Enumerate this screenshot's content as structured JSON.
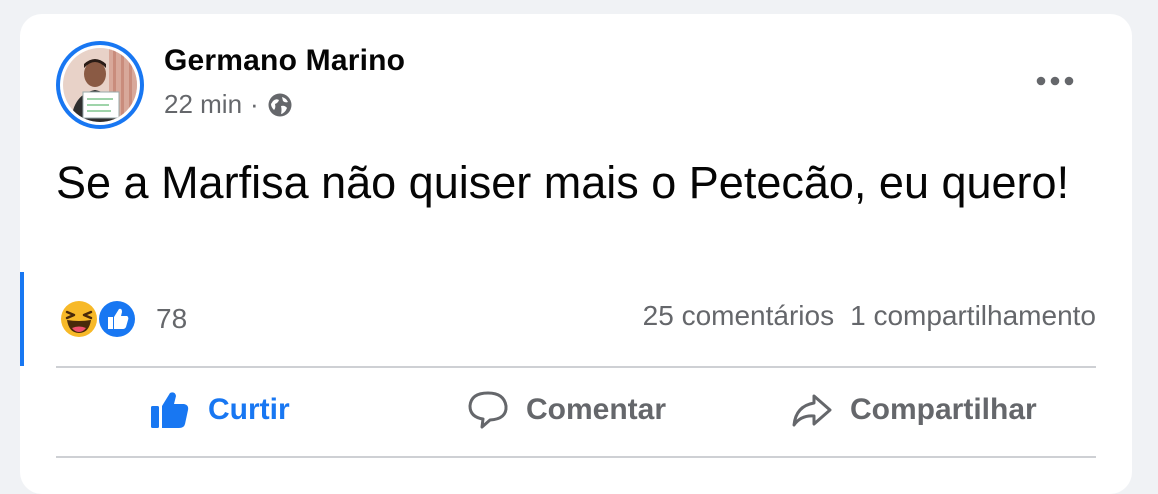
{
  "post": {
    "author": "Germano Marino",
    "time": "22 min",
    "separator": "·",
    "privacy_icon": "globe-icon",
    "text": "Se a Marfisa não quiser mais o Petecão, eu quero!",
    "reactions": {
      "icons": [
        "haha-icon",
        "like-reaction-icon"
      ],
      "count": "78"
    },
    "comments": "25 comentários",
    "shares": "1 compartilhamento"
  },
  "actions": {
    "like": "Curtir",
    "comment": "Comentar",
    "share": "Compartilhar"
  },
  "colors": {
    "brand_blue": "#1877f2",
    "text_primary": "#050505",
    "text_secondary": "#65676b",
    "background": "#f0f2f5"
  }
}
